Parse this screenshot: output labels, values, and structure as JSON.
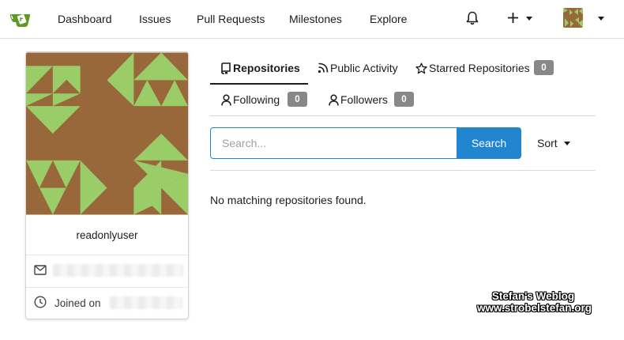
{
  "nav": {
    "items": [
      "Dashboard",
      "Issues",
      "Pull Requests",
      "Milestones",
      "Explore"
    ],
    "icons": [
      "gitea-logo-icon",
      "bell-icon",
      "plus-icon",
      "avatar"
    ]
  },
  "profile": {
    "username": "readonlyuser",
    "joined_label": "Joined on"
  },
  "tabs": {
    "repositories": "Repositories",
    "public_activity": "Public Activity",
    "starred": "Starred Repositories",
    "starred_count": "0",
    "following": "Following",
    "following_count": "0",
    "followers": "Followers",
    "followers_count": "0"
  },
  "search": {
    "placeholder": "Search...",
    "button": "Search",
    "sort_label": "Sort"
  },
  "content": {
    "empty_message": "No matching repositories found."
  },
  "watermark": {
    "line1": "Stefan's Weblog",
    "line2": "www.strobelstefan.org"
  },
  "colors": {
    "accent": "#2185d0",
    "brand_green": "#609926",
    "avatar_bg": "#99683a",
    "avatar_fg": "#9acd67",
    "badge": "#888888"
  }
}
